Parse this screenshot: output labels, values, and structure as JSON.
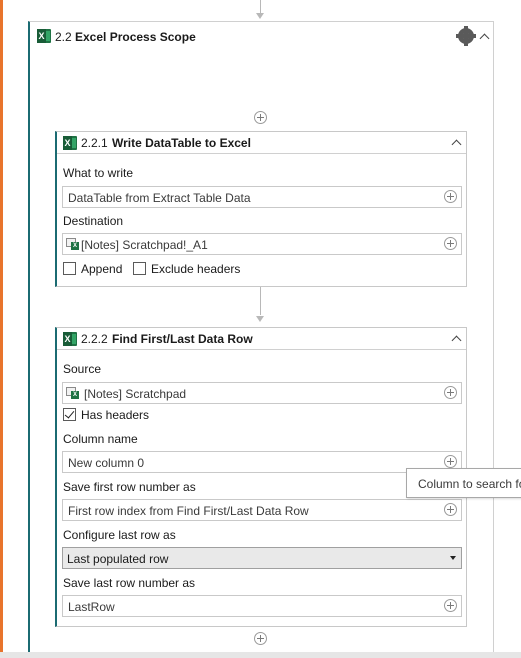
{
  "scope": {
    "number": "2.2",
    "title": "Excel Process Scope"
  },
  "write_activity": {
    "number": "2.2.1",
    "title": "Write DataTable to Excel",
    "what_label": "What to write",
    "what_value": "DataTable from Extract Table Data",
    "dest_label": "Destination",
    "dest_value": "[Notes] Scratchpad!_A1",
    "append_label": "Append",
    "append_checked": false,
    "exclude_label": "Exclude headers",
    "exclude_checked": false
  },
  "find_activity": {
    "number": "2.2.2",
    "title": "Find First/Last Data Row",
    "source_label": "Source",
    "source_value": "[Notes] Scratchpad",
    "has_headers_label": "Has headers",
    "has_headers_checked": true,
    "column_label": "Column name",
    "column_value": "New column 0",
    "first_row_label": "Save first row number as",
    "first_row_value": "First row index from Find First/Last Data Row",
    "configure_label": "Configure last row as",
    "configure_value": "Last populated row",
    "last_row_label": "Save last row number as",
    "last_row_value": "LastRow"
  },
  "tooltip": {
    "text": "Column to search for"
  },
  "colors": {
    "accent_left": "#e8742c",
    "activity_border": "#1b6b72",
    "excel_green": "#1f7244"
  },
  "icons": [
    "excel-icon",
    "gear-icon",
    "chevron-up-icon",
    "add-icon",
    "sheet-icon",
    "dropdown-arrow-icon"
  ]
}
